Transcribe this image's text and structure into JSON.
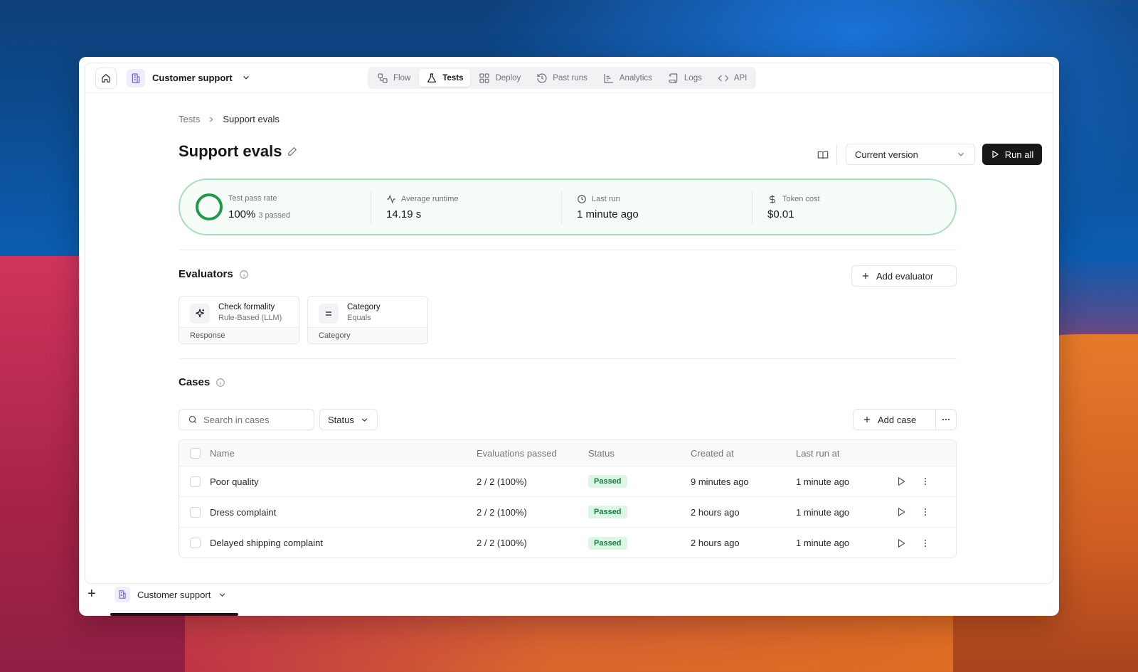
{
  "header": {
    "project_name": "Customer support",
    "nav": [
      {
        "label": "Flow",
        "icon": "flow-icon",
        "active": false
      },
      {
        "label": "Tests",
        "icon": "flask-icon",
        "active": true
      },
      {
        "label": "Deploy",
        "icon": "grid-icon",
        "active": false
      },
      {
        "label": "Past runs",
        "icon": "history-icon",
        "active": false
      },
      {
        "label": "Analytics",
        "icon": "chart-icon",
        "active": false
      },
      {
        "label": "Logs",
        "icon": "scroll-icon",
        "active": false
      },
      {
        "label": "API",
        "icon": "code-icon",
        "active": false
      }
    ]
  },
  "breadcrumb": {
    "parent": "Tests",
    "current": "Support evals"
  },
  "page": {
    "title": "Support evals",
    "version_select": "Current version",
    "run_all_label": "Run all"
  },
  "stats": {
    "pass_rate_label": "Test pass rate",
    "pass_rate_value": "100%",
    "pass_rate_sub": "3 passed",
    "runtime_label": "Average runtime",
    "runtime_value": "14.19 s",
    "last_run_label": "Last run",
    "last_run_value": "1 minute ago",
    "token_cost_label": "Token cost",
    "token_cost_value": "$0.01",
    "accent_color": "#1e9b47"
  },
  "evaluators": {
    "title": "Evaluators",
    "add_label": "Add evaluator",
    "items": [
      {
        "name": "Check formality",
        "type": "Rule-Based (LLM)",
        "field": "Response",
        "icon": "sparkle-icon"
      },
      {
        "name": "Category",
        "type": "Equals",
        "field": "Category",
        "icon": "equals-icon"
      }
    ]
  },
  "cases": {
    "title": "Cases",
    "search_placeholder": "Search in cases",
    "status_filter": "Status",
    "add_label": "Add case",
    "columns": [
      "Name",
      "Evaluations passed",
      "Status",
      "Created at",
      "Last run at"
    ],
    "rows": [
      {
        "name": "Poor quality",
        "evaluations": "2 / 2 (100%)",
        "status": "Passed",
        "created": "9 minutes ago",
        "last_run": "1 minute ago"
      },
      {
        "name": "Dress complaint",
        "evaluations": "2 / 2 (100%)",
        "status": "Passed",
        "created": "2 hours ago",
        "last_run": "1 minute ago"
      },
      {
        "name": "Delayed shipping complaint",
        "evaluations": "2 / 2 (100%)",
        "status": "Passed",
        "created": "2 hours ago",
        "last_run": "1 minute ago"
      }
    ]
  },
  "bottom_bar": {
    "tab_label": "Customer support",
    "add_symbol": "+"
  }
}
